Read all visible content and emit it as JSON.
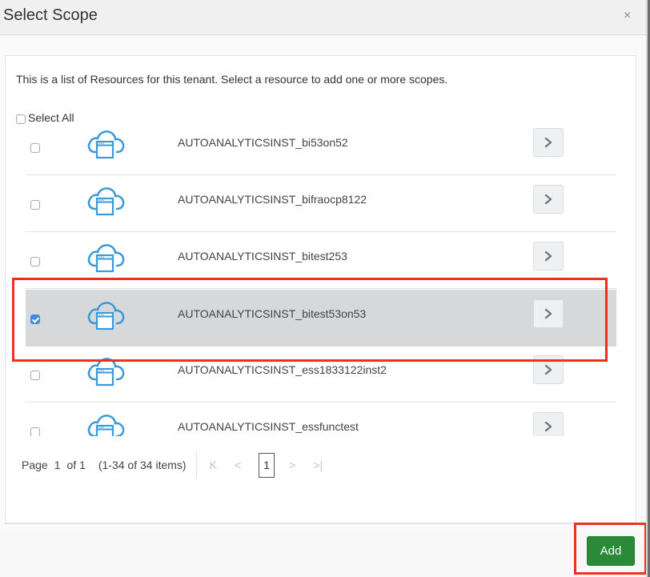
{
  "dialog": {
    "title": "Select Scope",
    "close_label": "×"
  },
  "description": "This is a list of Resources for this tenant. Select a resource to add one or more scopes.",
  "select_all": {
    "label": "Select All",
    "checked": false
  },
  "resources": [
    {
      "name": "AUTOANALYTICSINST_bi53on52",
      "checked": false,
      "icon": "cloud-window-icon"
    },
    {
      "name": "AUTOANALYTICSINST_bifraocp8122",
      "checked": false,
      "icon": "cloud-window-icon"
    },
    {
      "name": "AUTOANALYTICSINST_bitest253",
      "checked": false,
      "icon": "cloud-window-icon"
    },
    {
      "name": "AUTOANALYTICSINST_bitest53on53",
      "checked": true,
      "icon": "cloud-window-icon"
    },
    {
      "name": "AUTOANALYTICSINST_ess1833122inst2",
      "checked": false,
      "icon": "cloud-window-icon"
    },
    {
      "name": "AUTOANALYTICSINST_essfunctest",
      "checked": false,
      "icon": "cloud-window-icon"
    }
  ],
  "pagination": {
    "page_label": "Page",
    "current_page": "1",
    "of_label": "of 1",
    "range": "(1-34 of 34 items)",
    "first_icon": "K",
    "prev_icon": "<",
    "page_button": "1",
    "next_icon": ">",
    "last_icon": ">|"
  },
  "footer": {
    "add_label": "Add"
  },
  "colors": {
    "accent_blue": "#3b8fe4",
    "icon_blue": "#3a9ad9",
    "add_green": "#2a8a37",
    "highlight_red": "#f0301f",
    "selected_row": "#d7d8da"
  }
}
